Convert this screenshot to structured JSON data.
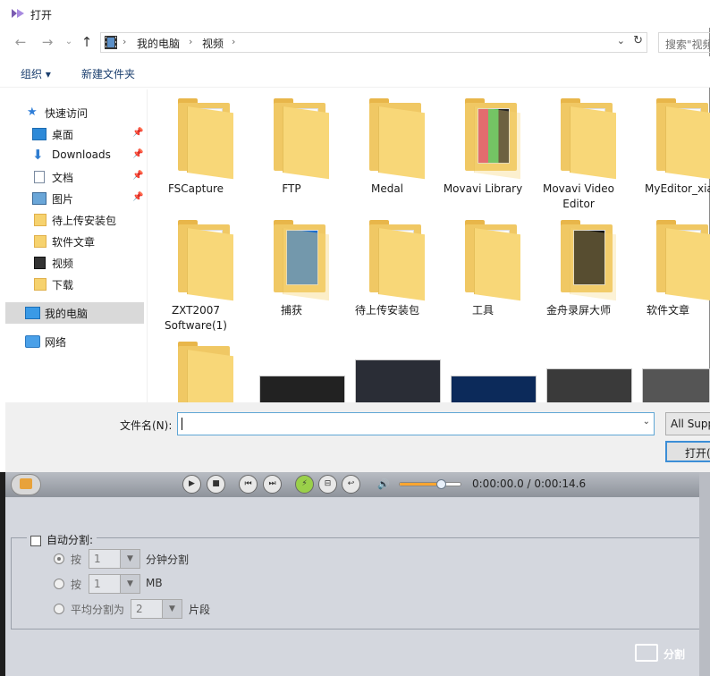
{
  "dialog": {
    "title": "打开",
    "address": {
      "crumbs": [
        "我的电脑",
        "视频"
      ]
    },
    "search_placeholder": "搜索\"视频\"",
    "toolbar": {
      "organize": "组织 ▾",
      "new_folder": "新建文件夹"
    },
    "sidebar": {
      "quick_access": "快速访问",
      "items": [
        {
          "label": "桌面",
          "pinned": true
        },
        {
          "label": "Downloads",
          "pinned": true
        },
        {
          "label": "文档",
          "pinned": true
        },
        {
          "label": "图片",
          "pinned": true
        },
        {
          "label": "待上传安装包",
          "pinned": false
        },
        {
          "label": "软件文章",
          "pinned": false
        },
        {
          "label": "视频",
          "pinned": false
        },
        {
          "label": "下载",
          "pinned": false
        }
      ],
      "this_pc": "我的电脑",
      "network": "网络"
    },
    "files": [
      "FSCapture",
      "FTP",
      "Medal",
      "Movavi Library",
      "Movavi Video Editor",
      "MyEditor_xiaba",
      "ZXT2007 Software(1)",
      "捕获",
      "待上传安装包",
      "工具",
      "金舟录屏大师",
      "软件文章"
    ],
    "filename_label": "文件名(N):",
    "filename_value": "",
    "filetype": "All Supp",
    "open_button": "打开("
  },
  "host": {
    "time_display": "0:00:00.0 / 0:00:14.6",
    "volume_level": 0.68,
    "auto_split_label": "自动分割:",
    "auto_split_checked": false,
    "options": [
      {
        "prefix": "按",
        "value": "1",
        "suffix": "分钟分割",
        "selected": true
      },
      {
        "prefix": "按",
        "value": "1",
        "suffix": "MB",
        "selected": false
      },
      {
        "prefix": "平均分割为",
        "value": "2",
        "suffix": "片段",
        "selected": false
      }
    ],
    "split_button": "分割"
  },
  "colors": {
    "accent": "#3c8ed6",
    "folder": "#f8d778",
    "selection": "#d9d9d9"
  }
}
